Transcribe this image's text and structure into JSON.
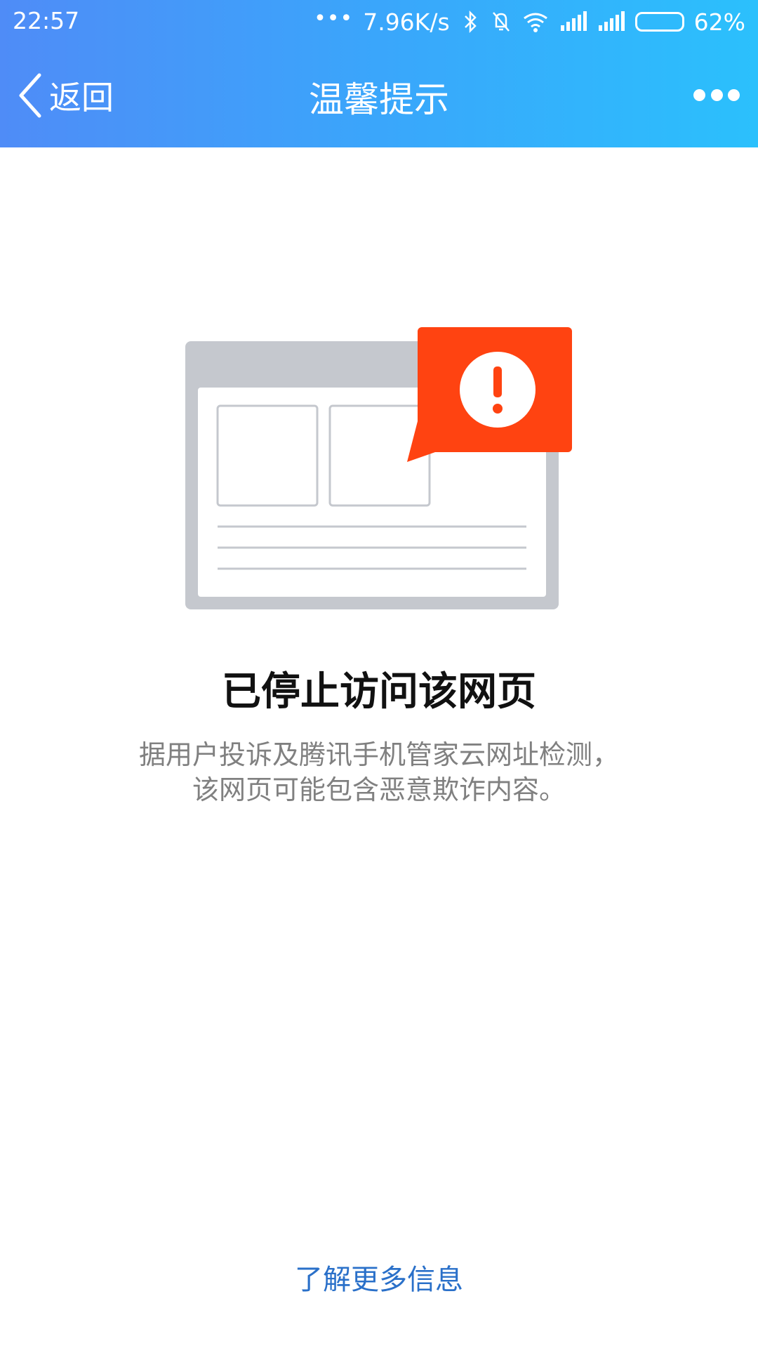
{
  "status_bar": {
    "time": "22:57",
    "network_speed": "7.96K/s",
    "battery": "62%",
    "battery_level": 0.62,
    "icons": [
      "more-dots-icon",
      "bluetooth-icon",
      "mute-icon",
      "wifi-icon",
      "signal-icon",
      "signal-icon",
      "battery-icon"
    ]
  },
  "nav": {
    "back_label": "返回",
    "title": "温馨提示",
    "more_icon": "more-dots-icon"
  },
  "warning": {
    "title": "已停止访问该网页",
    "line1": "据用户投诉及腾讯手机管家云网址检测，",
    "line2": "该网页可能包含恶意欺诈内容。",
    "illustration_icon": "blocked-webpage-warning-icon"
  },
  "footer": {
    "learn_more": "了解更多信息"
  },
  "colors": {
    "header_start": "#4f8cf7",
    "header_end": "#2bc0fc",
    "alert_red": "#ff4311",
    "link_blue": "#2a70c9"
  }
}
